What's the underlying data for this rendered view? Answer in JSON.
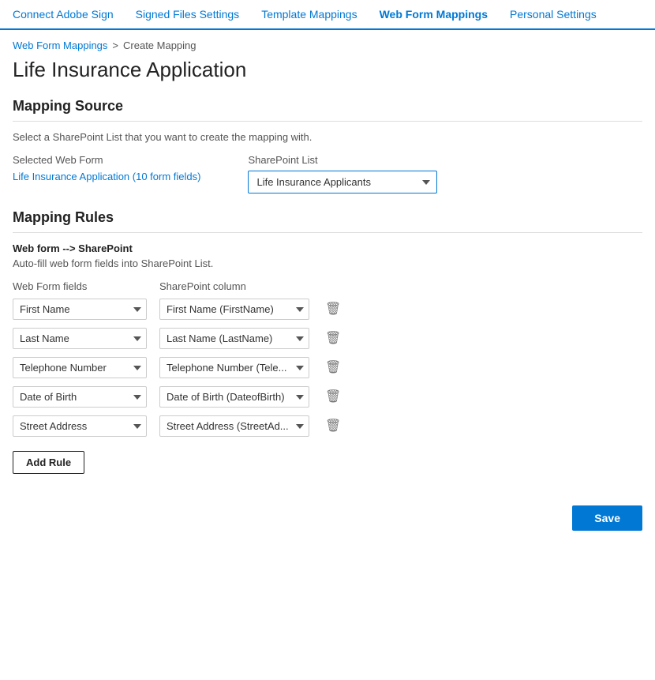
{
  "nav": {
    "items": [
      {
        "label": "Connect Adobe Sign",
        "active": false
      },
      {
        "label": "Signed Files Settings",
        "active": false
      },
      {
        "label": "Template Mappings",
        "active": false
      },
      {
        "label": "Web Form Mappings",
        "active": true
      },
      {
        "label": "Personal Settings",
        "active": false
      }
    ]
  },
  "breadcrumb": {
    "parent": "Web Form Mappings",
    "separator": ">",
    "current": "Create Mapping"
  },
  "page_title": "Life Insurance Application",
  "mapping_source": {
    "section_title": "Mapping Source",
    "description": "Select a SharePoint List that you want to create the mapping with.",
    "selected_web_form_label": "Selected Web Form",
    "selected_web_form_value": "Life Insurance Application (10 form fields)",
    "sharepoint_list_label": "SharePoint List",
    "sharepoint_list_value": "Life Insurance Applicants",
    "sharepoint_list_options": [
      "Life Insurance Applicants"
    ]
  },
  "mapping_rules": {
    "section_title": "Mapping Rules",
    "direction_label": "Web form --> SharePoint",
    "autofill_label": "Auto-fill web form fields into SharePoint List.",
    "web_form_fields_header": "Web Form fields",
    "sharepoint_column_header": "SharePoint column",
    "rules": [
      {
        "web_form_field": "First Name",
        "sharepoint_column": "First Name (FirstName)"
      },
      {
        "web_form_field": "Last Name",
        "sharepoint_column": "Last Name (LastName)"
      },
      {
        "web_form_field": "Telephone Number",
        "sharepoint_column": "Telephone Number (Tele..."
      },
      {
        "web_form_field": "Date of Birth",
        "sharepoint_column": "Date of Birth (DateofBirth)"
      },
      {
        "web_form_field": "Street Address",
        "sharepoint_column": "Street Address (StreetAd..."
      }
    ],
    "add_rule_label": "Add Rule",
    "save_label": "Save"
  }
}
